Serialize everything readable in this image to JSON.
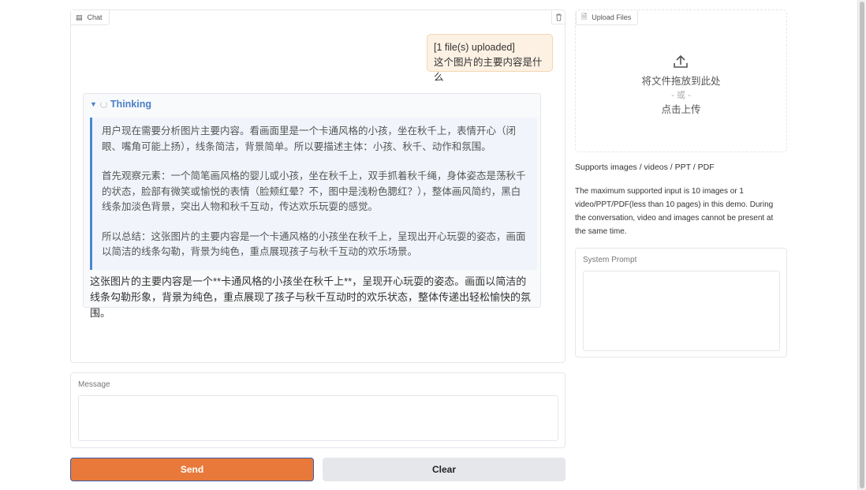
{
  "chat": {
    "label": "Chat",
    "user_message": {
      "line1": "[1 file(s) uploaded]",
      "line2": "这个图片的主要内容是什么"
    },
    "thinking": {
      "title": "Thinking",
      "paragraphs": [
        "用户现在需要分析图片主要内容。看画面里是一个卡通风格的小孩，坐在秋千上，表情开心（闭眼、嘴角可能上扬），线条简洁，背景简单。所以要描述主体：小孩、秋千、动作和氛围。",
        "首先观察元素：一个简笔画风格的婴儿或小孩，坐在秋千上，双手抓着秋千绳，身体姿态是荡秋千的状态，脸部有微笑或愉悦的表情（脸颊红晕？不，图中是浅粉色腮红？），整体画风简约，黑白线条加淡色背景，突出人物和秋千互动，传达欢乐玩耍的感觉。",
        "所以总结：这张图片的主要内容是一个卡通风格的小孩坐在秋千上，呈现出开心玩耍的姿态，画面以简洁的线条勾勒，背景为纯色，重点展现孩子与秋千互动的欢乐场景。"
      ]
    },
    "answer": "这张图片的主要内容是一个**卡通风格的小孩坐在秋千上**，呈现开心玩耍的姿态。画面以简洁的线条勾勒形象，背景为纯色，重点展现了孩子与秋千互动时的欢乐状态，整体传递出轻松愉快的氛围。"
  },
  "message": {
    "label": "Message",
    "value": ""
  },
  "buttons": {
    "send": "Send",
    "clear": "Clear"
  },
  "upload": {
    "label": "Upload Files",
    "drop_text": "将文件拖放到此处",
    "or_text": "- 或 -",
    "click_text": "点击上传"
  },
  "supports": "Supports images / videos / PPT / PDF",
  "notice": "The maximum supported input is 10 images or 1 video/PPT/PDF(less than 10 pages) in this demo. During the conversation, video and images cannot be present at the same time.",
  "system_prompt": {
    "label": "System Prompt",
    "value": ""
  },
  "colors": {
    "accent": "#e8793a",
    "thinking": "#4a7fc9"
  }
}
